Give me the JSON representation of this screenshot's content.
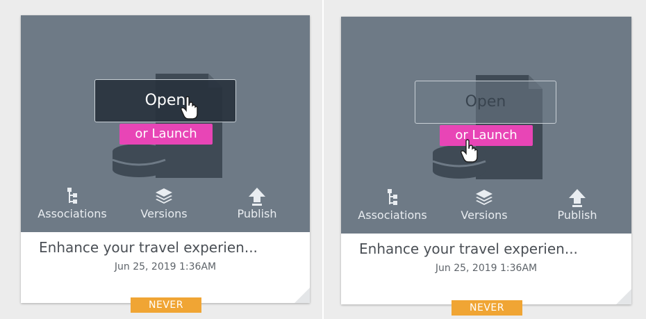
{
  "cards": [
    {
      "open_label": "Open",
      "launch_label": "or Launch",
      "actions": [
        "Associations",
        "Versions",
        "Publish"
      ],
      "title": "Enhance your travel experien...",
      "date": "Jun 25, 2019 1:36AM",
      "badge": "NEVER",
      "hover_target": "open-button"
    },
    {
      "open_label": "Open",
      "launch_label": "or Launch",
      "actions": [
        "Associations",
        "Versions",
        "Publish"
      ],
      "title": "Enhance your travel experien...",
      "date": "Jun 25, 2019 1:36AM",
      "badge": "NEVER",
      "hover_target": "launch-button"
    }
  ],
  "colors": {
    "thumb_bg": "#6e7a86",
    "launch_accent": "#e845b6",
    "badge_bg": "#f0a534"
  },
  "icons": {
    "associations": "hierarchy-tree-icon",
    "versions": "layers-stack-icon",
    "publish": "upload-arrow-icon",
    "cursor": "hand-pointer-icon"
  }
}
